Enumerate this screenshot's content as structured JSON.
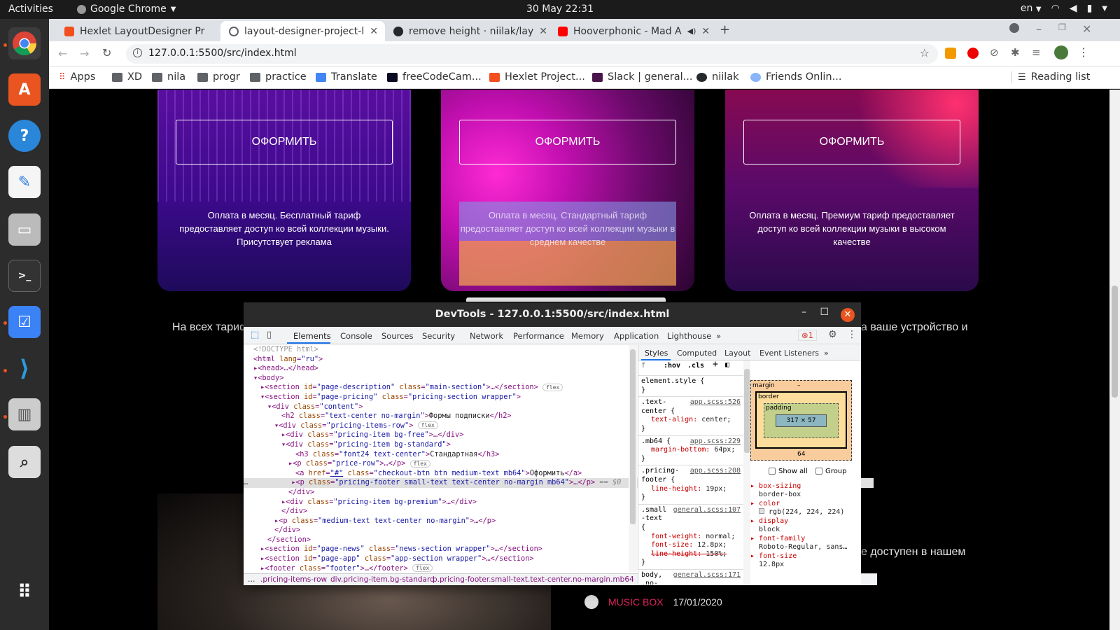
{
  "topbar": {
    "activities": "Activities",
    "app": "Google Chrome",
    "clock": "30 May  22:31",
    "lang": "en"
  },
  "tabs": [
    {
      "title": "Hexlet LayoutDesigner Pr",
      "color": "#f24e1e"
    },
    {
      "title": "layout-designer-project-l",
      "color": "#5f6368"
    },
    {
      "title": "remove height · niilak/lay",
      "color": "#24292e"
    },
    {
      "title": "Hooverphonic - Mad A",
      "color": "#ff0000"
    }
  ],
  "omnibox": {
    "url": "127.0.0.1:5500/src/index.html"
  },
  "bookmarks": {
    "apps": "Apps",
    "items": [
      "XD",
      "nila",
      "progr",
      "practice",
      "Translate",
      "freeCodeCam...",
      "Hexlet Project...",
      "Slack | general...",
      "niilak",
      "Friends Onlin..."
    ],
    "reading_list": "Reading list"
  },
  "page": {
    "cards": [
      {
        "button": "ОФОРМИТЬ",
        "desc": "Оплата в месяц. Бесплатный тариф предоставляет доступ ко всей коллекции музыки. Присутствует реклама"
      },
      {
        "button": "ОФОРМИТЬ",
        "desc": "Оплата в месяц. Стандартный тариф предоставляет доступ ко всей коллекции музыки в среднем качестве"
      },
      {
        "button": "ОФОРМИТЬ",
        "desc": "Оплата в месяц. Премиум тариф предоставляет доступ ко всей коллекции музыки в высоком качестве"
      }
    ],
    "text_left": "На всех тариф",
    "text_right": "а ваше устройство и",
    "text_right2": "е доступен в нашем",
    "footer_brand": "MUSIC BOX",
    "footer_date": "17/01/2020"
  },
  "devtools": {
    "title": "DevTools - 127.0.0.1:5500/src/index.html",
    "tabs": [
      "Elements",
      "Console",
      "Sources",
      "Security",
      "Network",
      "Performance",
      "Memory",
      "Application",
      "Lighthouse"
    ],
    "error_count": "1",
    "breadcrumbs": [
      ".pricing-items-row",
      "div.pricing-item.bg-standard",
      "p.pricing-footer.small-text.text-center.no-margin.mb64"
    ],
    "styles_tabs": [
      "Styles",
      "Computed",
      "Layout",
      "Event Listeners"
    ],
    "filter": {
      "hov": ":hov",
      "cls": ".cls"
    },
    "element_style": "element.style {",
    "rules": [
      {
        "selector": ".text-center {",
        "src": "app.scss:526",
        "prop": "text-align",
        "val": "center;"
      },
      {
        "selector": ".mb64 {",
        "src": "app.scss:229",
        "prop": "margin-bottom",
        "val": "64px;"
      },
      {
        "selector": ".pricing-footer {",
        "src": "app.scss:208",
        "prop": "line-height",
        "val": "19px;"
      },
      {
        "selector": ".small-text {",
        "src": "general.scss:107",
        "prop": "font-weight",
        "val": "normal;",
        "prop2": "font-size",
        "val2": "12.8px;",
        "prop3": "line-height",
        "val3": "150%;"
      },
      {
        "selector": "body, .no-margin {",
        "src": "general.scss:171"
      }
    ],
    "boxmodel": {
      "margin_label": "margin",
      "border_label": "border",
      "padding_label": "padding",
      "content": "317 × 57",
      "margin_bottom": "64",
      "dash": "–"
    },
    "computed": {
      "show_all": "Show all",
      "group": "Group",
      "props": [
        {
          "name": "box-sizing",
          "val": "border-box"
        },
        {
          "name": "color",
          "val": "rgb(224, 224, 224)"
        },
        {
          "name": "display",
          "val": "block"
        },
        {
          "name": "font-family",
          "val": "Roboto-Regular, sans…"
        },
        {
          "name": "font-size",
          "val": "12.8px"
        }
      ]
    },
    "dom": {
      "l01": "<!DOCTYPE html>",
      "l02a": "<html ",
      "l02b": "lang",
      "l02c": "\"ru\"",
      "l03": "<head>…</head>",
      "l04": "<body>",
      "l05a": "<section ",
      "l05b": "id",
      "l05c": "\"page-description\"",
      "l05d": "class",
      "l05e": "\"main-section\"",
      "l05f": ">…</section>",
      "l06a": "<section ",
      "l06b": "id",
      "l06c": "\"page-pricing\"",
      "l06d": "class",
      "l06e": "\"pricing-section wrapper\"",
      "l07a": "<div ",
      "l07b": "class",
      "l07c": "\"content\"",
      "l08a": "<h2 ",
      "l08b": "class",
      "l08c": "\"text-center no-margin\"",
      "l08d": "Формы подписки",
      "l08e": "</h2>",
      "l09a": "<div ",
      "l09b": "class",
      "l09c": "\"pricing-items-row\"",
      "l10a": "<div ",
      "l10b": "class",
      "l10c": "\"pricing-item bg-free\"",
      "l10d": ">…</div>",
      "l11a": "<div ",
      "l11b": "class",
      "l11c": "\"pricing-item bg-standard\"",
      "l12a": "<h3 ",
      "l12b": "class",
      "l12c": "\"font24 text-center\"",
      "l12d": "Стандартная",
      "l12e": "</h3>",
      "l13a": "<p ",
      "l13b": "class",
      "l13c": "\"price-row\"",
      "l13d": ">…</p>",
      "l14a": "<a ",
      "l14b": "href",
      "l14c": "\"#\"",
      "l14d": "class",
      "l14e": "\"checkout-btn btn medium-text mb64\"",
      "l14f": "Оформить",
      "l14g": "</a>",
      "l15a": "<p ",
      "l15b": "class",
      "l15c": "\"pricing-footer small-text text-center no-margin mb64\"",
      "l15d": ">…</p>",
      "l15e": " == $0",
      "l16": "</div>",
      "l17a": "<div ",
      "l17b": "class",
      "l17c": "\"pricing-item bg-premium\"",
      "l17d": ">…</div>",
      "l18": "</div>",
      "l19a": "<p ",
      "l19b": "class",
      "l19c": "\"medium-text text-center no-margin\"",
      "l19d": ">…</p>",
      "l20": "</div>",
      "l21": "</section>",
      "l22a": "<section ",
      "l22b": "id",
      "l22c": "\"page-news\"",
      "l22d": "class",
      "l22e": "\"news-section wrapper\"",
      "l22f": ">…</section>",
      "l23a": "<section ",
      "l23b": "id",
      "l23c": "\"page-app\"",
      "l23d": "class",
      "l23e": "\"app-section wrapper\"",
      "l23f": ">…</section>",
      "l24a": "<footer ",
      "l24b": "class",
      "l24c": "\"footer\"",
      "l24d": ">…</footer>",
      "flex": "flex",
      "dots": "…"
    }
  },
  "colors": {
    "accent_orange": "#e95420",
    "devtools_blue": "#1a73e8",
    "music_box": "#e0245e"
  }
}
